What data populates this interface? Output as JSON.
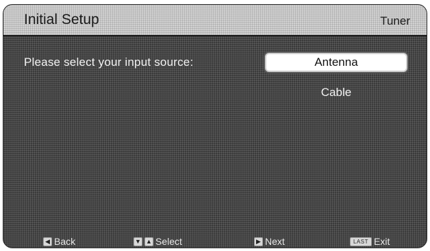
{
  "header": {
    "title": "Initial Setup",
    "section": "Tuner"
  },
  "main": {
    "prompt": "Please select your input source:",
    "options": [
      {
        "label": "Antenna",
        "selected": true
      },
      {
        "label": "Cable",
        "selected": false
      }
    ]
  },
  "footer": {
    "hints": [
      {
        "keys": [
          "left-arrow-icon"
        ],
        "label": "Back"
      },
      {
        "keys": [
          "down-arrow-icon",
          "up-arrow-icon"
        ],
        "label": "Select"
      },
      {
        "keys": [
          "right-arrow-icon"
        ],
        "label": "Next"
      },
      {
        "keys": [
          "last-key"
        ],
        "key_label": "LAST",
        "label": "Exit"
      }
    ]
  },
  "colors": {
    "header_bg": "#d2d2d2",
    "screen_bg": "#3a3a3a",
    "text_light": "#f2f2f2",
    "selected_bg": "#ffffff"
  }
}
